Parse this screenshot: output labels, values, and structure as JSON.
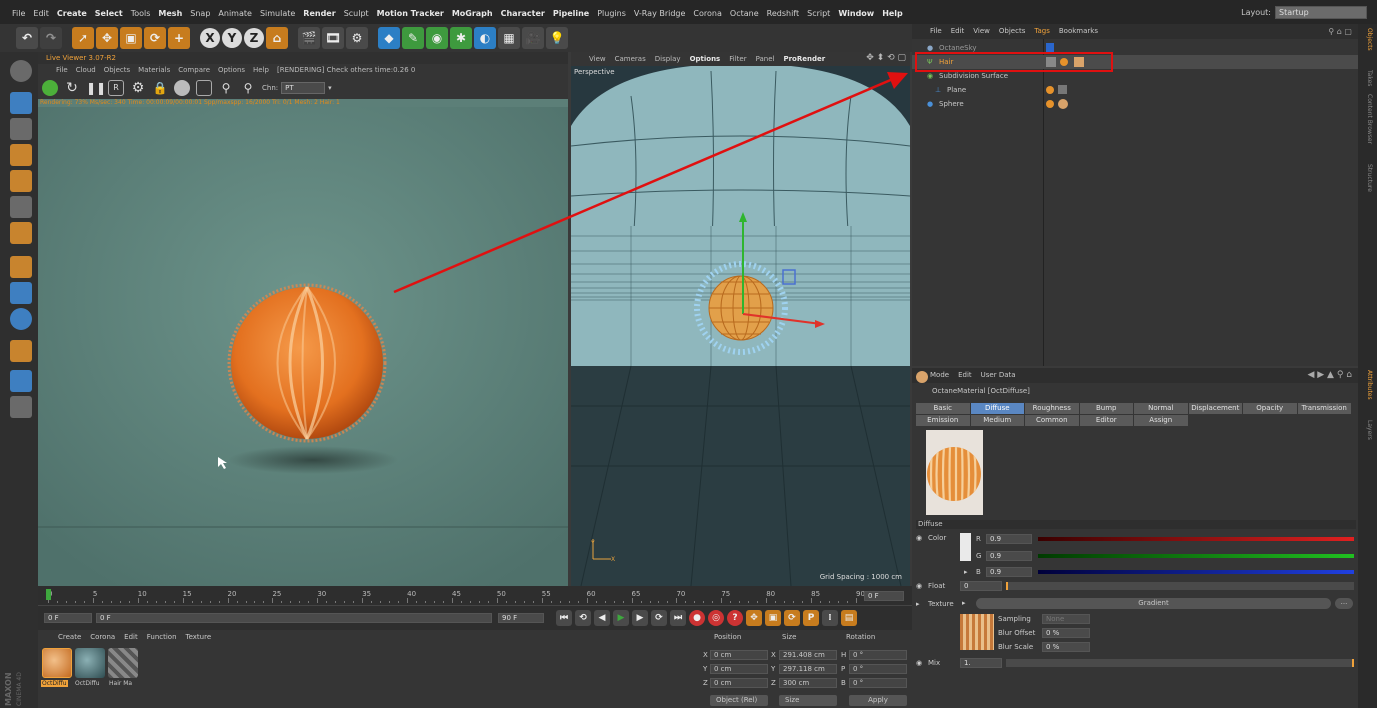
{
  "menubar": {
    "items": [
      "File",
      "Edit",
      "Create",
      "Select",
      "Tools",
      "Mesh",
      "Snap",
      "Animate",
      "Simulate",
      "Render",
      "Sculpt",
      "Motion Tracker",
      "MoGraph",
      "Character",
      "Pipeline",
      "Plugins",
      "V-Ray Bridge",
      "Corona",
      "Octane",
      "Redshift",
      "Script",
      "Window",
      "Help"
    ],
    "bold": [
      false,
      false,
      true,
      true,
      false,
      true,
      false,
      false,
      false,
      true,
      false,
      true,
      true,
      true,
      true,
      false,
      false,
      false,
      false,
      false,
      false,
      true,
      true
    ],
    "layout_label": "Layout:",
    "layout_value": "Startup"
  },
  "toolbar": {
    "axis_x": "X",
    "axis_y": "Y",
    "axis_z": "Z"
  },
  "live_viewer": {
    "title": "Live Viewer 3.07-R2",
    "menu": [
      "File",
      "Cloud",
      "Objects",
      "Materials",
      "Compare",
      "Options",
      "Help"
    ],
    "status": "[RENDERING] Check others time:0.26  0",
    "chn_label": "Chn:",
    "chn_value": "PT",
    "info_line": "Rendering: 73% Ms/sec: 340 Time: 00:00:09/00:00:01 Spp/maxspp: 16/2000 Tri: 0/1 Mesh: 2 Hair: 1"
  },
  "viewport": {
    "menu": [
      "View",
      "Cameras",
      "Display",
      "Options",
      "Filter",
      "Panel",
      "ProRender"
    ],
    "bold": [
      false,
      false,
      false,
      true,
      false,
      false,
      true
    ],
    "label": "Perspective",
    "grid_spacing": "Grid Spacing : 1000 cm",
    "axis_y": "Y",
    "axis_x": "X"
  },
  "object_manager": {
    "menu": [
      "File",
      "Edit",
      "View",
      "Objects",
      "Tags",
      "Bookmarks"
    ],
    "objects": [
      {
        "name": "OctaneSky"
      },
      {
        "name": "Hair"
      },
      {
        "name": "Subdivision Surface"
      },
      {
        "name": "Plane"
      },
      {
        "name": "Sphere"
      }
    ]
  },
  "right_tabs": [
    "Objects",
    "Takes",
    "Content Browser",
    "Structure",
    "Attributes",
    "Layers"
  ],
  "attributes": {
    "menu": [
      "Mode",
      "Edit",
      "User Data"
    ],
    "title": "OctaneMaterial [OctDiffuse]",
    "tabs_row1": [
      "Basic",
      "Diffuse",
      "Roughness",
      "Bump",
      "Normal",
      "Displacement",
      "Opacity",
      "Transmission"
    ],
    "tabs_row2": [
      "Emission",
      "Medium",
      "Common",
      "Editor",
      "Assign"
    ],
    "active_tab": "Diffuse",
    "section": "Diffuse",
    "color_label": "Color",
    "r_label": "R",
    "r_value": "0.9",
    "g_label": "G",
    "g_value": "0.9",
    "b_label": "B",
    "b_value": "0.9",
    "float_label": "Float",
    "float_value": "0",
    "texture_label": "Texture",
    "texture_value": "Gradient",
    "sampling_label": "Sampling",
    "sampling_value": "None",
    "blur_offset_label": "Blur Offset",
    "blur_offset_value": "0 %",
    "blur_scale_label": "Blur Scale",
    "blur_scale_value": "0 %",
    "mix_label": "Mix",
    "mix_value": "1."
  },
  "timeline": {
    "ticks": [
      "0",
      "5",
      "10",
      "15",
      "20",
      "25",
      "30",
      "35",
      "40",
      "45",
      "50",
      "55",
      "60",
      "65",
      "70",
      "75",
      "80",
      "85",
      "90"
    ],
    "frame_right": "0 F",
    "start": "0 F",
    "cur": "0 F",
    "end": "90 F",
    "end2": "90 F"
  },
  "materials": {
    "menu": [
      "Create",
      "Corona",
      "Edit",
      "Function",
      "Texture"
    ],
    "items": [
      {
        "label": "OctDiffu",
        "color": "#e0862a"
      },
      {
        "label": "OctDiffu",
        "color": "#466b70"
      },
      {
        "label": "Hair Ma",
        "color": "#6a6a6a"
      }
    ]
  },
  "coords": {
    "position": "Position",
    "size": "Size",
    "rotation": "Rotation",
    "px": "X",
    "px_val": "0 cm",
    "py": "Y",
    "py_val": "0 cm",
    "pz": "Z",
    "pz_val": "0 cm",
    "sx": "X",
    "sx_val": "291.408 cm",
    "sy": "Y",
    "sy_val": "297.118 cm",
    "sz": "Z",
    "sz_val": "300 cm",
    "rh": "H",
    "rh_val": "0 °",
    "rp": "P",
    "rp_val": "0 °",
    "rb": "B",
    "rb_val": "0 °",
    "mode": "Object (Rel)",
    "size_mode": "Size",
    "apply": "Apply"
  },
  "brand": {
    "maxon": "MAXON",
    "c4d": "CINEMA 4D"
  },
  "colors": {
    "accent_orange": "#f0a23a",
    "active_tab": "#5a87c2",
    "annotation_red": "#e01010"
  }
}
